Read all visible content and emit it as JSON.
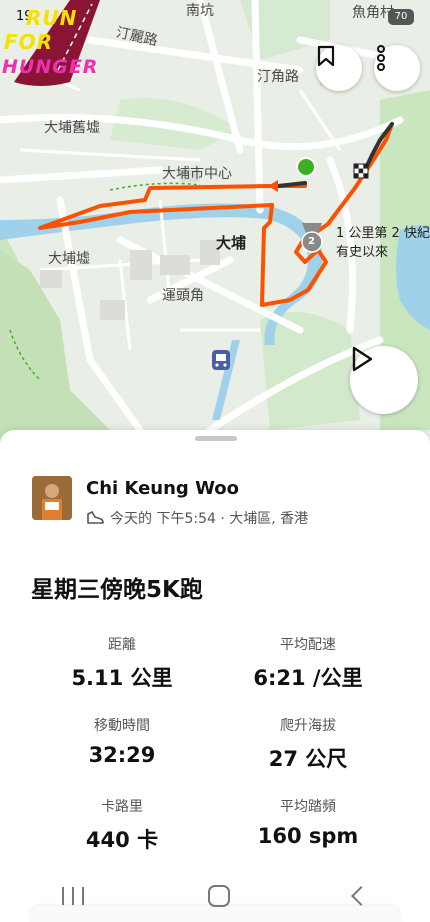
{
  "status": {
    "time": "19",
    "battery": "70"
  },
  "logo": {
    "line1": "RUN",
    "line2": "FOR",
    "line3": "HUNGER"
  },
  "map": {
    "labels": {
      "nankeng": "南坑",
      "yujiaocun": "魚角村",
      "dingliluo": "汀麗路",
      "dinglu": "汀角路",
      "old_market": "大埔舊墟",
      "market_center": "大埔市中心",
      "taipo": "大埔",
      "taipo_xu": "大埔墟",
      "yuntoujiao": "運頭角"
    },
    "achievement_text_line1": "1 公里第 2 快紀",
    "achievement_text_line2": "有史以來",
    "achievement_rank": "2"
  },
  "activity": {
    "athlete_name": "Chi Keung Woo",
    "meta": "今天的 下午5:54 · 大埔區, 香港",
    "title": "星期三傍晚5K跑",
    "stats": [
      {
        "label": "距離",
        "value": "5.11 公里"
      },
      {
        "label": "平均配速",
        "value": "6:21 /公里"
      },
      {
        "label": "移動時間",
        "value": "32:29"
      },
      {
        "label": "爬升海拔",
        "value": "27 公尺"
      },
      {
        "label": "卡路里",
        "value": "440 卡"
      },
      {
        "label": "平均踏頻",
        "value": "160 spm"
      }
    ]
  },
  "colors": {
    "route": "#fc5200",
    "start": "#3cb023",
    "water": "#9fd2ea",
    "park": "#c9e6bf"
  },
  "icons": [
    "bookmark-icon",
    "more-vert-icon",
    "play-icon",
    "shoe-icon",
    "finish-flag-icon",
    "rail-station-icon",
    "segment-medal-icon"
  ]
}
